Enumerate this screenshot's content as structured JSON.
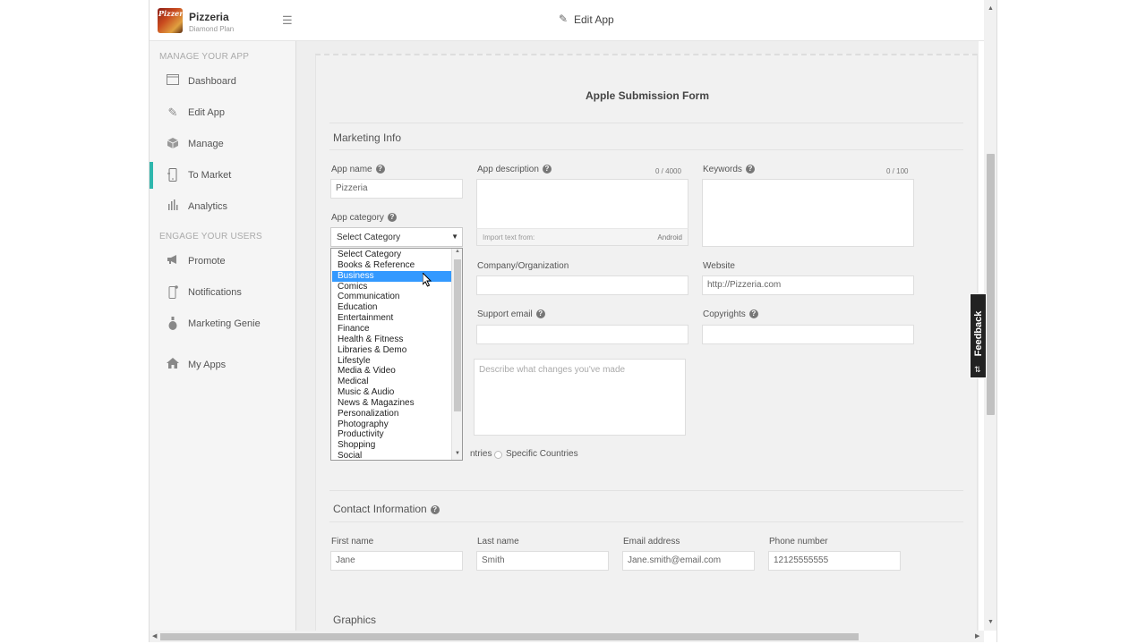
{
  "brand": {
    "name": "Pizzeria",
    "plan": "Diamond Plan",
    "logo_text": "Pizzeria"
  },
  "topbar": {
    "title": "Edit App"
  },
  "sidebar": {
    "section_manage": "MANAGE YOUR APP",
    "section_engage": "ENGAGE YOUR USERS",
    "items": [
      {
        "label": "Dashboard",
        "icon": "dashboard-icon"
      },
      {
        "label": "Edit App",
        "icon": "pencil-icon"
      },
      {
        "label": "Manage",
        "icon": "cube-icon"
      },
      {
        "label": "To Market",
        "icon": "phone-icon",
        "active": true
      },
      {
        "label": "Analytics",
        "icon": "bar-chart-icon"
      },
      {
        "label": "Promote",
        "icon": "megaphone-icon"
      },
      {
        "label": "Notifications",
        "icon": "phone-notification-icon"
      },
      {
        "label": "Marketing Genie",
        "icon": "genie-bottle-icon"
      },
      {
        "label": "My Apps",
        "icon": "home-icon"
      }
    ]
  },
  "form": {
    "title": "Apple Submission Form",
    "marketing": {
      "title": "Marketing Info",
      "app_name_label": "App name",
      "app_name_value": "Pizzeria",
      "app_desc_label": "App description",
      "app_desc_counter": "0 / 4000",
      "import_label": "Import text from:",
      "import_source": "Android",
      "keywords_label": "Keywords",
      "keywords_counter": "0 / 100",
      "category_label": "App category",
      "category_value": "Select Category",
      "company_label": "Company/Organization",
      "website_label": "Website",
      "website_value": "http://Pizzeria.com",
      "support_label": "Support email",
      "copyrights_label": "Copyrights",
      "changes_placeholder": "Describe what changes you've made",
      "countries_partial": "ntries",
      "specific_countries": "Specific Countries"
    },
    "category_options": [
      "Select Category",
      "Books & Reference",
      "Business",
      "Comics",
      "Communication",
      "Education",
      "Entertainment",
      "Finance",
      "Health & Fitness",
      "Libraries & Demo",
      "Lifestyle",
      "Media & Video",
      "Medical",
      "Music & Audio",
      "News & Magazines",
      "Personalization",
      "Photography",
      "Productivity",
      "Shopping",
      "Social"
    ],
    "category_highlighted": "Business",
    "contact": {
      "title": "Contact Information",
      "first_name_label": "First name",
      "first_name_value": "Jane",
      "last_name_label": "Last name",
      "last_name_value": "Smith",
      "email_label": "Email address",
      "email_value": "Jane.smith@email.com",
      "phone_label": "Phone number",
      "phone_value": "12125555555"
    },
    "graphics": {
      "title": "Graphics"
    }
  },
  "feedback": {
    "label": "Feedback"
  },
  "colors": {
    "accent": "#2fb7ad",
    "selection": "#3399ff"
  }
}
